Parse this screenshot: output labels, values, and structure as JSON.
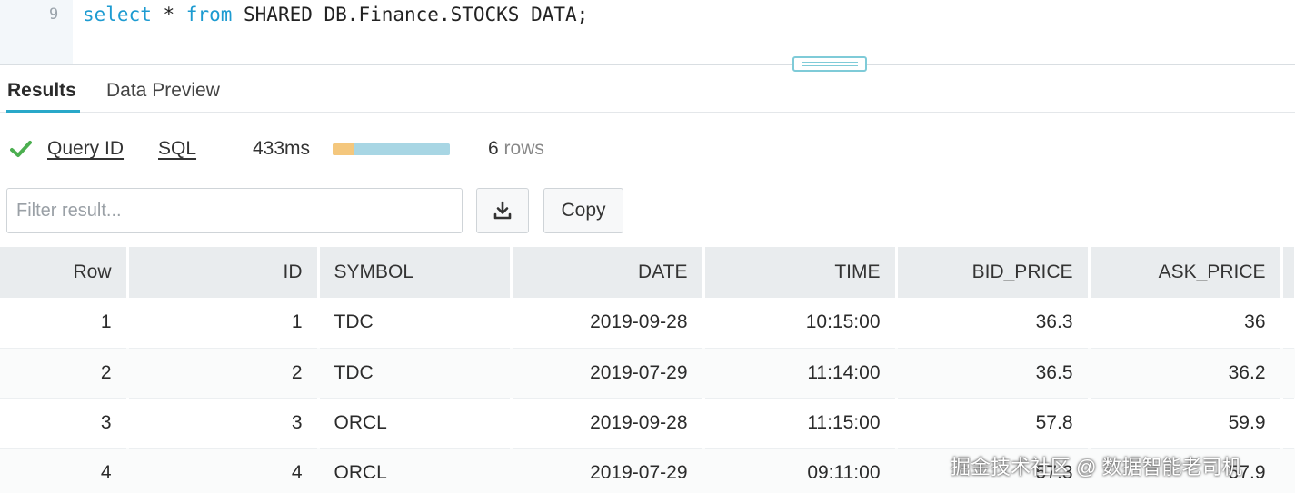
{
  "editor": {
    "line_number": "9",
    "code": {
      "kw_select": "select",
      "star": " * ",
      "kw_from": "from",
      "rest": " SHARED_DB.Finance.STOCKS_DATA;"
    }
  },
  "tabs": [
    {
      "label": "Results",
      "active": true
    },
    {
      "label": "Data Preview",
      "active": false
    }
  ],
  "status": {
    "query_id_label": "Query ID",
    "sql_label": "SQL",
    "duration": "433ms",
    "progress_queued_fraction": 0.18,
    "row_count": "6",
    "rows_word": "rows",
    "colors": {
      "success": "#4caf50",
      "progress_queued": "#f4c77d",
      "progress_exec": "#a8d6e4"
    }
  },
  "toolbar": {
    "filter_placeholder": "Filter result...",
    "download_icon": "download-icon",
    "copy_label": "Copy"
  },
  "table": {
    "columns": [
      "Row",
      "ID",
      "SYMBOL",
      "DATE",
      "TIME",
      "BID_PRICE",
      "ASK_PRICE"
    ],
    "rows": [
      [
        "1",
        "1",
        "TDC",
        "2019-09-28",
        "10:15:00",
        "36.3",
        "36"
      ],
      [
        "2",
        "2",
        "TDC",
        "2019-07-29",
        "11:14:00",
        "36.5",
        "36.2"
      ],
      [
        "3",
        "3",
        "ORCL",
        "2019-09-28",
        "11:15:00",
        "57.8",
        "59.9"
      ],
      [
        "4",
        "4",
        "ORCL",
        "2019-07-29",
        "09:11:00",
        "57.3",
        "57.9"
      ]
    ]
  },
  "watermark": "掘金技术社区 @ 数据智能老司机"
}
